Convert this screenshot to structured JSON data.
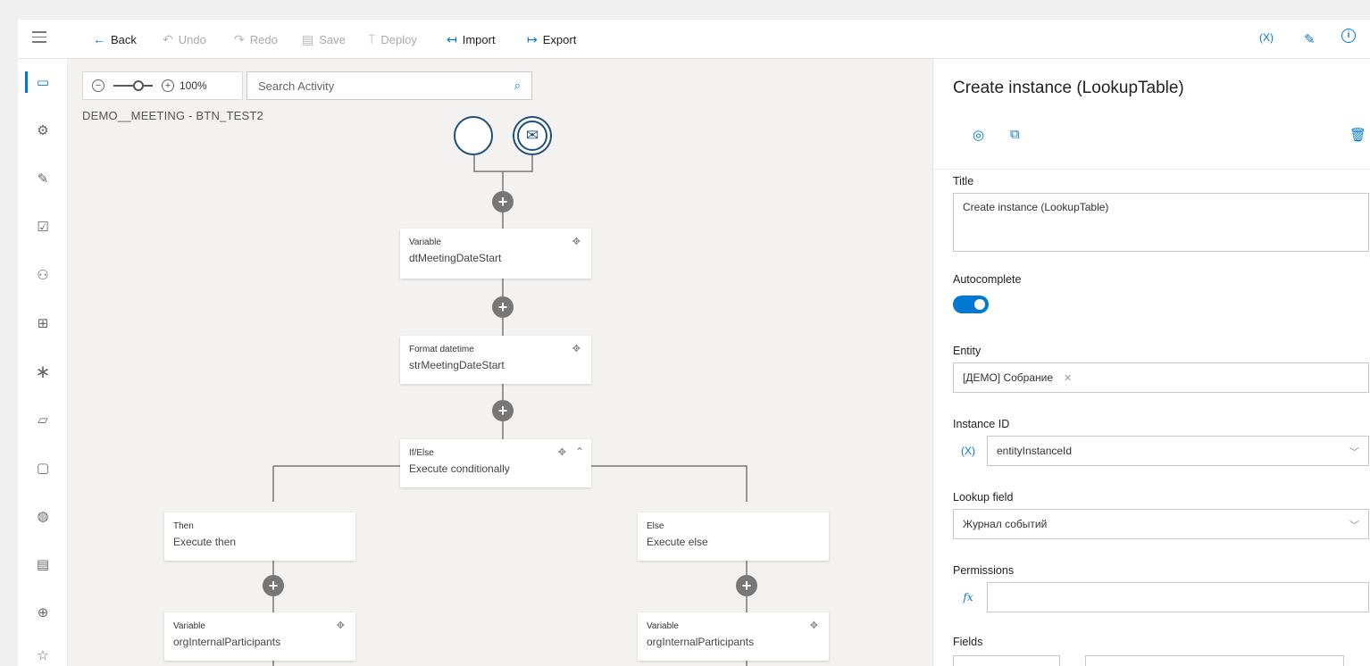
{
  "toolbar": {
    "back_label": "Back",
    "undo_label": "Undo",
    "redo_label": "Redo",
    "save_label": "Save",
    "deploy_label": "Deploy",
    "import_label": "Import",
    "export_label": "Export",
    "variables_label": "(X)"
  },
  "canvas": {
    "zoom_level": "100%",
    "search_placeholder": "Search Activity",
    "process_name": "DEMO__MEETING - BTN_TEST2"
  },
  "nodes": {
    "n1": {
      "type": "Variable",
      "title": "dtMeetingDateStart"
    },
    "n2": {
      "type": "Format datetime",
      "title": "strMeetingDateStart"
    },
    "n3": {
      "type": "If/Else",
      "title": "Execute conditionally"
    },
    "then": {
      "type": "Then",
      "title": "Execute then"
    },
    "else": {
      "type": "Else",
      "title": "Execute else"
    },
    "v_left": {
      "type": "Variable",
      "title": "orgInternalParticipants"
    },
    "v_right": {
      "type": "Variable",
      "title": "orgInternalParticipants"
    }
  },
  "panel": {
    "title": "Create instance (LookupTable)",
    "title_label": "Title",
    "title_value": "Create instance (LookupTable)",
    "autocomplete_label": "Autocomplete",
    "autocomplete_on": true,
    "entity_label": "Entity",
    "entity_value": "[ДЕМО] Собрание",
    "instance_id_label": "Instance ID",
    "instance_id_prefix": "(X)",
    "instance_id_value": "entityInstanceId",
    "lookup_field_label": "Lookup field",
    "lookup_field_value": "Журнал событий",
    "permissions_label": "Permissions",
    "permissions_prefix": "fx",
    "fields_label": "Fields"
  },
  "colors": {
    "accent": "#0078d4",
    "node_event": "#1e4e79",
    "add_button": "#777777"
  }
}
